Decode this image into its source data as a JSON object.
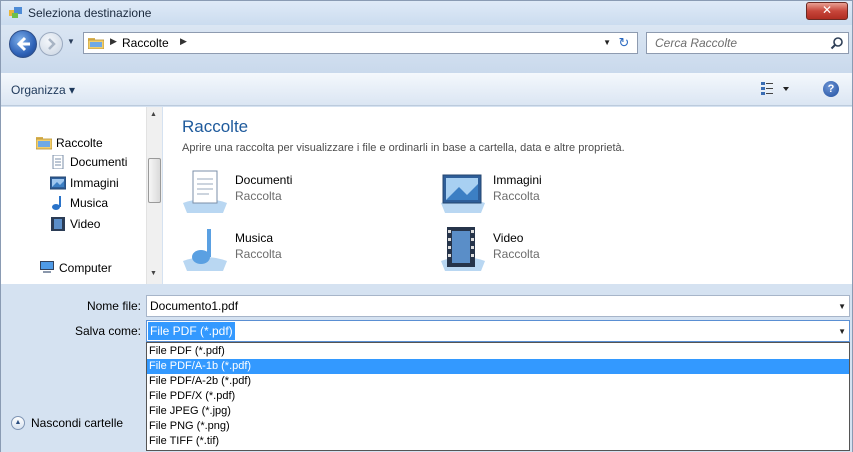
{
  "window": {
    "title": "Seleziona destinazione",
    "close_label": "✕"
  },
  "navigation": {
    "address_segment": "Raccolte",
    "search_placeholder": "Cerca Raccolte"
  },
  "toolbar": {
    "organize_label": "Organizza ▾"
  },
  "sidebar": {
    "items": [
      {
        "label": "Raccolte",
        "icon": "library-icon"
      },
      {
        "label": "Documenti",
        "icon": "documents-icon"
      },
      {
        "label": "Immagini",
        "icon": "pictures-icon"
      },
      {
        "label": "Musica",
        "icon": "music-icon"
      },
      {
        "label": "Video",
        "icon": "video-icon"
      },
      {
        "label": "Computer",
        "icon": "computer-icon"
      }
    ]
  },
  "content": {
    "title": "Raccolte",
    "description": "Aprire una raccolta per visualizzare i file e ordinarli in base a cartella, data e altre proprietà.",
    "libraries": [
      {
        "name": "Documenti",
        "type": "Raccolta",
        "icon": "documents-library-icon"
      },
      {
        "name": "Immagini",
        "type": "Raccolta",
        "icon": "pictures-library-icon"
      },
      {
        "name": "Musica",
        "type": "Raccolta",
        "icon": "music-library-icon"
      },
      {
        "name": "Video",
        "type": "Raccolta",
        "icon": "video-library-icon"
      }
    ]
  },
  "form": {
    "filename_label": "Nome file:",
    "filename_value": "Documento1.pdf",
    "savetype_label": "Salva come:",
    "savetype_value": "File PDF (*.pdf)",
    "hide_folders_label": "Nascondi cartelle"
  },
  "savetype_options": {
    "items": [
      "File PDF (*.pdf)",
      "File PDF/A-1b (*.pdf)",
      "File PDF/A-2b (*.pdf)",
      "File PDF/X (*.pdf)",
      "File JPEG (*.jpg)",
      "File PNG (*.png)",
      "File TIFF (*.tif)"
    ],
    "highlighted_index": 1
  },
  "colors": {
    "selection": "#3399ff",
    "title_blue": "#1e5a9c"
  }
}
